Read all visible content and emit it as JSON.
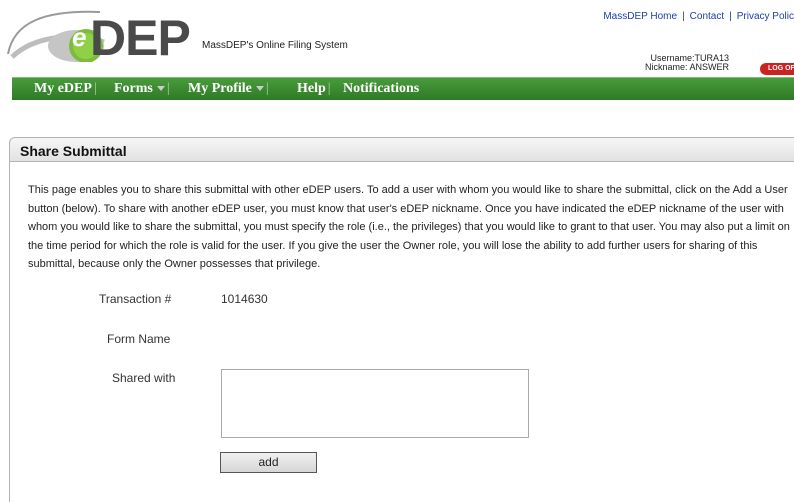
{
  "header": {
    "logo_e": "e",
    "logo_text": "DEP",
    "tagline": "MassDEP's Online Filing System",
    "links": [
      "MassDEP Home",
      "Contact",
      "Privacy Polic"
    ],
    "username_label": "Username:TURA13",
    "nickname_label": "Nickname: ANSWER",
    "logoff_label": "LOG OF"
  },
  "nav": {
    "items": [
      "My  eDEP",
      "Forms",
      "My  Profile",
      "Help",
      "Notifications"
    ]
  },
  "panel": {
    "title": "Share Submittal",
    "intro": "This page enables you to share this submittal with other eDEP users. To add a user with whom you would like to share the submittal, click on the Add a User button (below). To share with another eDEP user, you must know that user's eDEP nickname. Once you have indicated the eDEP nickname of the user with whom you would like to share the submittal, you must specify the role (i.e., the privileges) that you would like to grant to that user. You may also put a limit on the time period for which the role is valid for the user. If you give the user the Owner role, you will lose the ability to add further users for sharing of this submittal, because only the Owner possesses that privilege."
  },
  "form": {
    "transaction_label": "Transaction #",
    "transaction_value": "1014630",
    "form_name_label": "Form Name",
    "form_name_value": "",
    "shared_with_label": "Shared with",
    "add_button": "add"
  },
  "colors": {
    "nav_green": "#2d7a24",
    "link_blue": "#1a3fa8",
    "logoff_red": "#cc2222"
  }
}
